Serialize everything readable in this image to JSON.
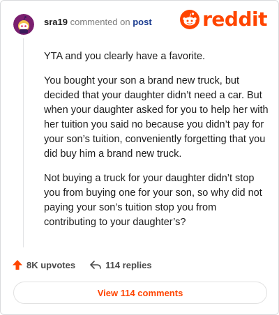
{
  "header": {
    "username": "sra19",
    "commented_text": "commented on",
    "post_link": "post",
    "brand": "reddit"
  },
  "comment": {
    "paragraphs": [
      "YTA and you clearly have a favorite.",
      "You bought your son a brand new truck, but decided that your daughter didn’t need a car. But when your daughter asked for you to help her with her tuition you said no because you didn’t pay for your son’s tuition, conveniently forgetting that you did buy him a brand new truck.",
      "Not buying a truck for your daughter didn’t stop you from buying one for your son, so why did not paying your son’s tuition stop you from contributing to your daughter’s?"
    ]
  },
  "actions": {
    "upvotes": "8K upvotes",
    "replies": "114 replies"
  },
  "view_button": "View 114 comments",
  "colors": {
    "brand_orange": "#ff4500",
    "link_blue": "#1a3b8f",
    "avatar_bg": "#7a1f6f"
  },
  "icons": {
    "avatar": "snoo-avatar",
    "logo": "reddit-snoo-icon",
    "upvote": "upvote-arrow-icon",
    "reply": "reply-arrow-icon"
  }
}
